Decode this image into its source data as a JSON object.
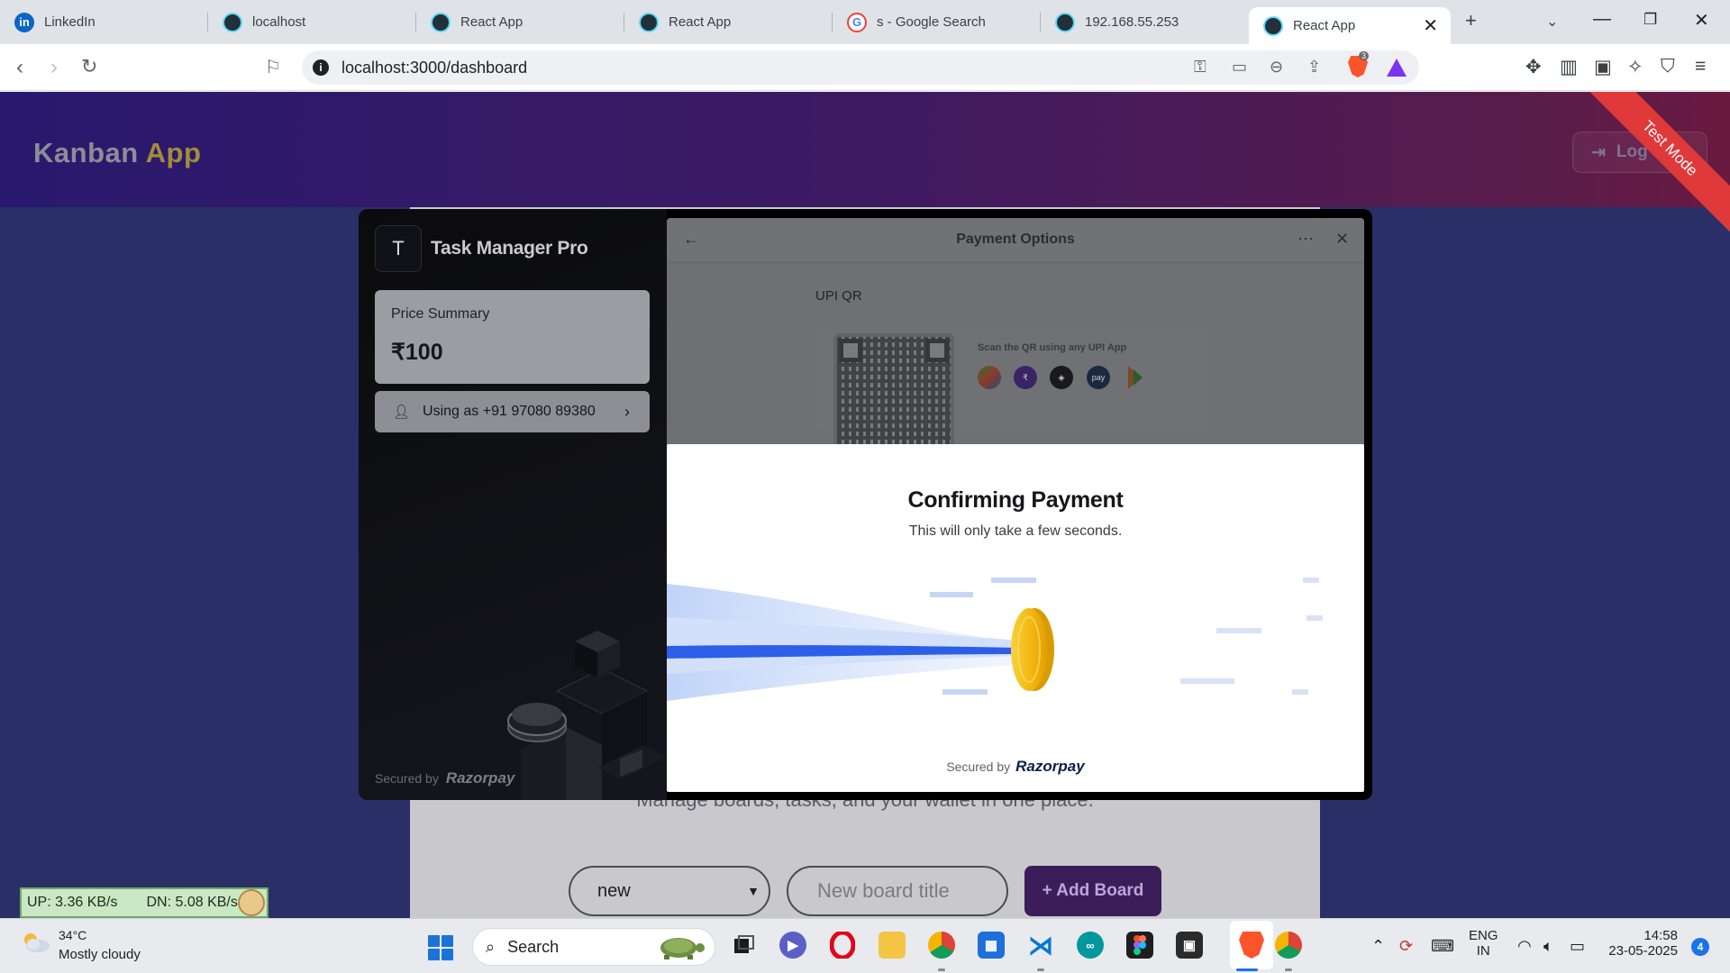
{
  "browser": {
    "tabs": [
      {
        "title": "LinkedIn",
        "icon": "linkedin-icon"
      },
      {
        "title": "localhost",
        "icon": "react-icon"
      },
      {
        "title": "React App",
        "icon": "react-icon"
      },
      {
        "title": "React App",
        "icon": "react-icon"
      },
      {
        "title": "s - Google Search",
        "icon": "google-icon"
      },
      {
        "title": "192.168.55.253",
        "icon": "react-icon"
      },
      {
        "title": "React App",
        "icon": "react-icon",
        "active": true
      }
    ],
    "url": "localhost:3000/dashboard",
    "brave_badge": "3"
  },
  "app": {
    "title_part1": "Kanban",
    "title_part2": "App",
    "logout_label": "Log",
    "test_mode_label": "Test Mode",
    "tagline": "Manage boards, tasks, and your wallet in one place.",
    "board_select_value": "new",
    "board_title_placeholder": "New board title",
    "add_board_label": "+ Add Board"
  },
  "checkout": {
    "merchant_initial": "T",
    "merchant_name": "Task Manager Pro",
    "price_summary_label": "Price Summary",
    "price_amount": "₹100",
    "user_label": "Using as +91 97080 89380",
    "secured_by": "Secured by",
    "brand": "Razorpay",
    "payment_options_title": "Payment Options",
    "upi_qr_label": "UPI QR",
    "scan_text": "Scan the QR using any UPI App",
    "upi_apps": [
      "gpay-icon",
      "phonepe-icon",
      "cred-icon",
      "paytm-icon",
      "bhim-icon"
    ],
    "confirm_title": "Confirming Payment",
    "confirm_subtitle": "This will only take a few seconds.",
    "confirm_secured_by": "Secured by",
    "confirm_brand": "Razorpay"
  },
  "netmon": {
    "up": "UP: 3.36 KB/s",
    "down": "DN: 5.08 KB/s"
  },
  "taskbar": {
    "weather_temp": "34°C",
    "weather_desc": "Mostly cloudy",
    "search_label": "Search",
    "lang_1": "ENG",
    "lang_2": "IN",
    "time": "14:58",
    "date": "23-05-2025",
    "notification_count": "4"
  },
  "colors": {
    "header_gradient_start": "#28196e",
    "header_gradient_end": "#6a1a40",
    "test_mode": "#e0393a",
    "coin": "#f5c518",
    "stream": "#2c5ee8"
  }
}
